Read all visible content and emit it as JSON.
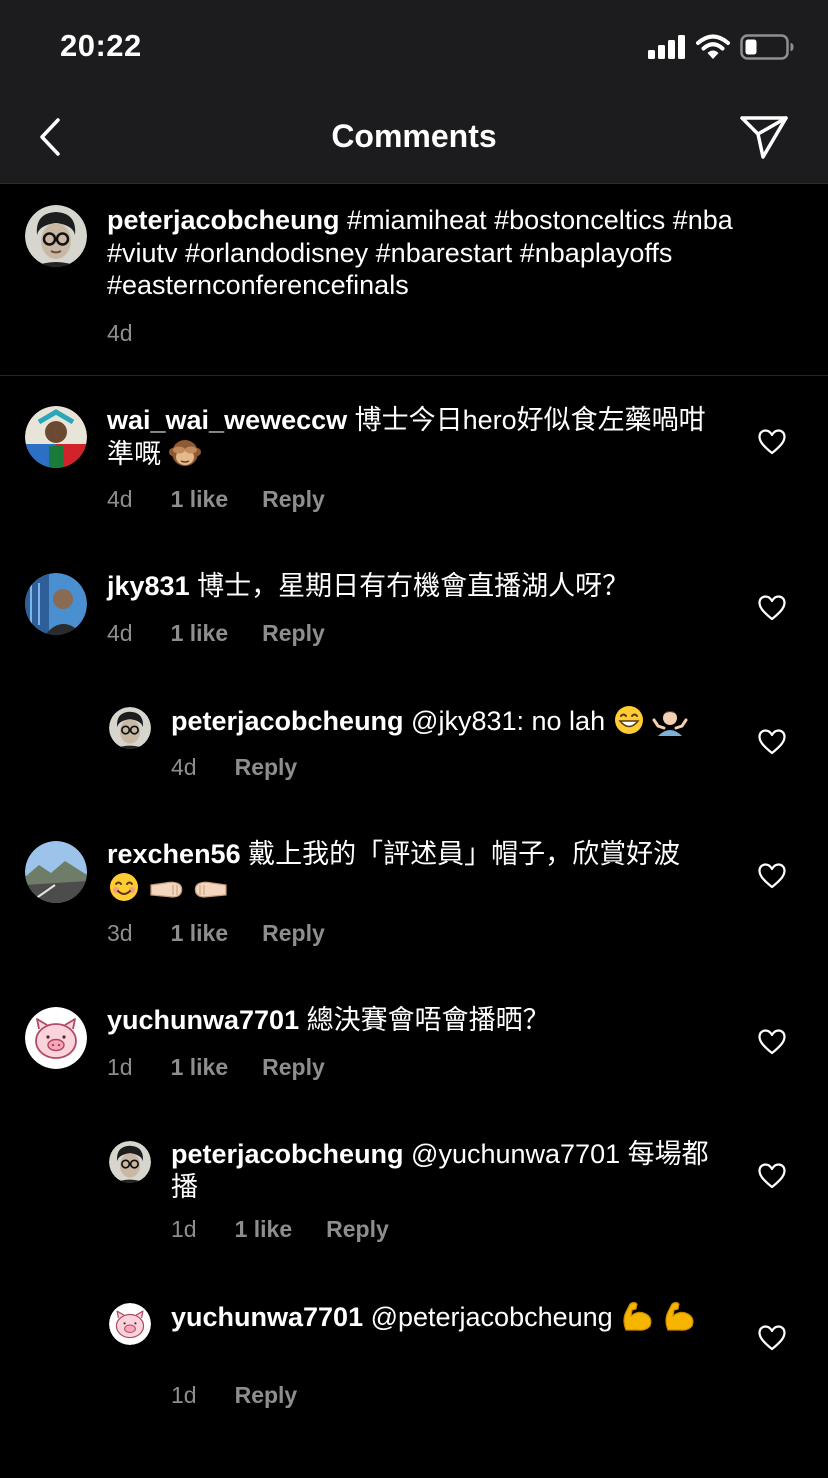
{
  "status": {
    "time": "20:22"
  },
  "header": {
    "title": "Comments"
  },
  "caption": {
    "username": "peterjacobcheung",
    "text": " #miamiheat #bostonceltics #nba #viutv #orlandodisney #nbarestart #nbaplayoffs #easternconferencefinals",
    "time": "4d"
  },
  "comments": [
    {
      "username": "wai_wai_weweccw",
      "text": " 博士今日hero好似食左藥喎咁準嘅",
      "emoji": [
        "see-no-evil-monkey"
      ],
      "time": "4d",
      "likes": "1 like",
      "reply": "Reply"
    },
    {
      "username": "jky831",
      "text": " 博士，星期日有冇機會直播湖人呀？",
      "time": "4d",
      "likes": "1 like",
      "reply": "Reply"
    },
    {
      "username": "peterjacobcheung",
      "mention": " @jky831:",
      "text": " no lah",
      "emoji": [
        "grinning-face",
        "person-shrugging"
      ],
      "time": "4d",
      "reply": "Reply"
    },
    {
      "username": "rexchen56",
      "text": " 戴上我的「評述員」帽子，欣賞好波",
      "emoji": [
        "smiling-face",
        "fist-bump-left",
        "fist-bump-right"
      ],
      "time": "3d",
      "likes": "1 like",
      "reply": "Reply"
    },
    {
      "username": "yuchunwa7701",
      "text": " 總決賽會唔會播晒？",
      "time": "1d",
      "likes": "1 like",
      "reply": "Reply"
    },
    {
      "username": "peterjacobcheung",
      "mention": " @yuchunwa7701",
      "text": " 每場都播",
      "time": "1d",
      "likes": "1 like",
      "reply": "Reply"
    },
    {
      "username": "yuchunwa7701",
      "mention": " @peterjacobcheung",
      "emoji": [
        "flexed-biceps",
        "flexed-biceps"
      ],
      "time": "1d",
      "reply": "Reply"
    }
  ]
}
